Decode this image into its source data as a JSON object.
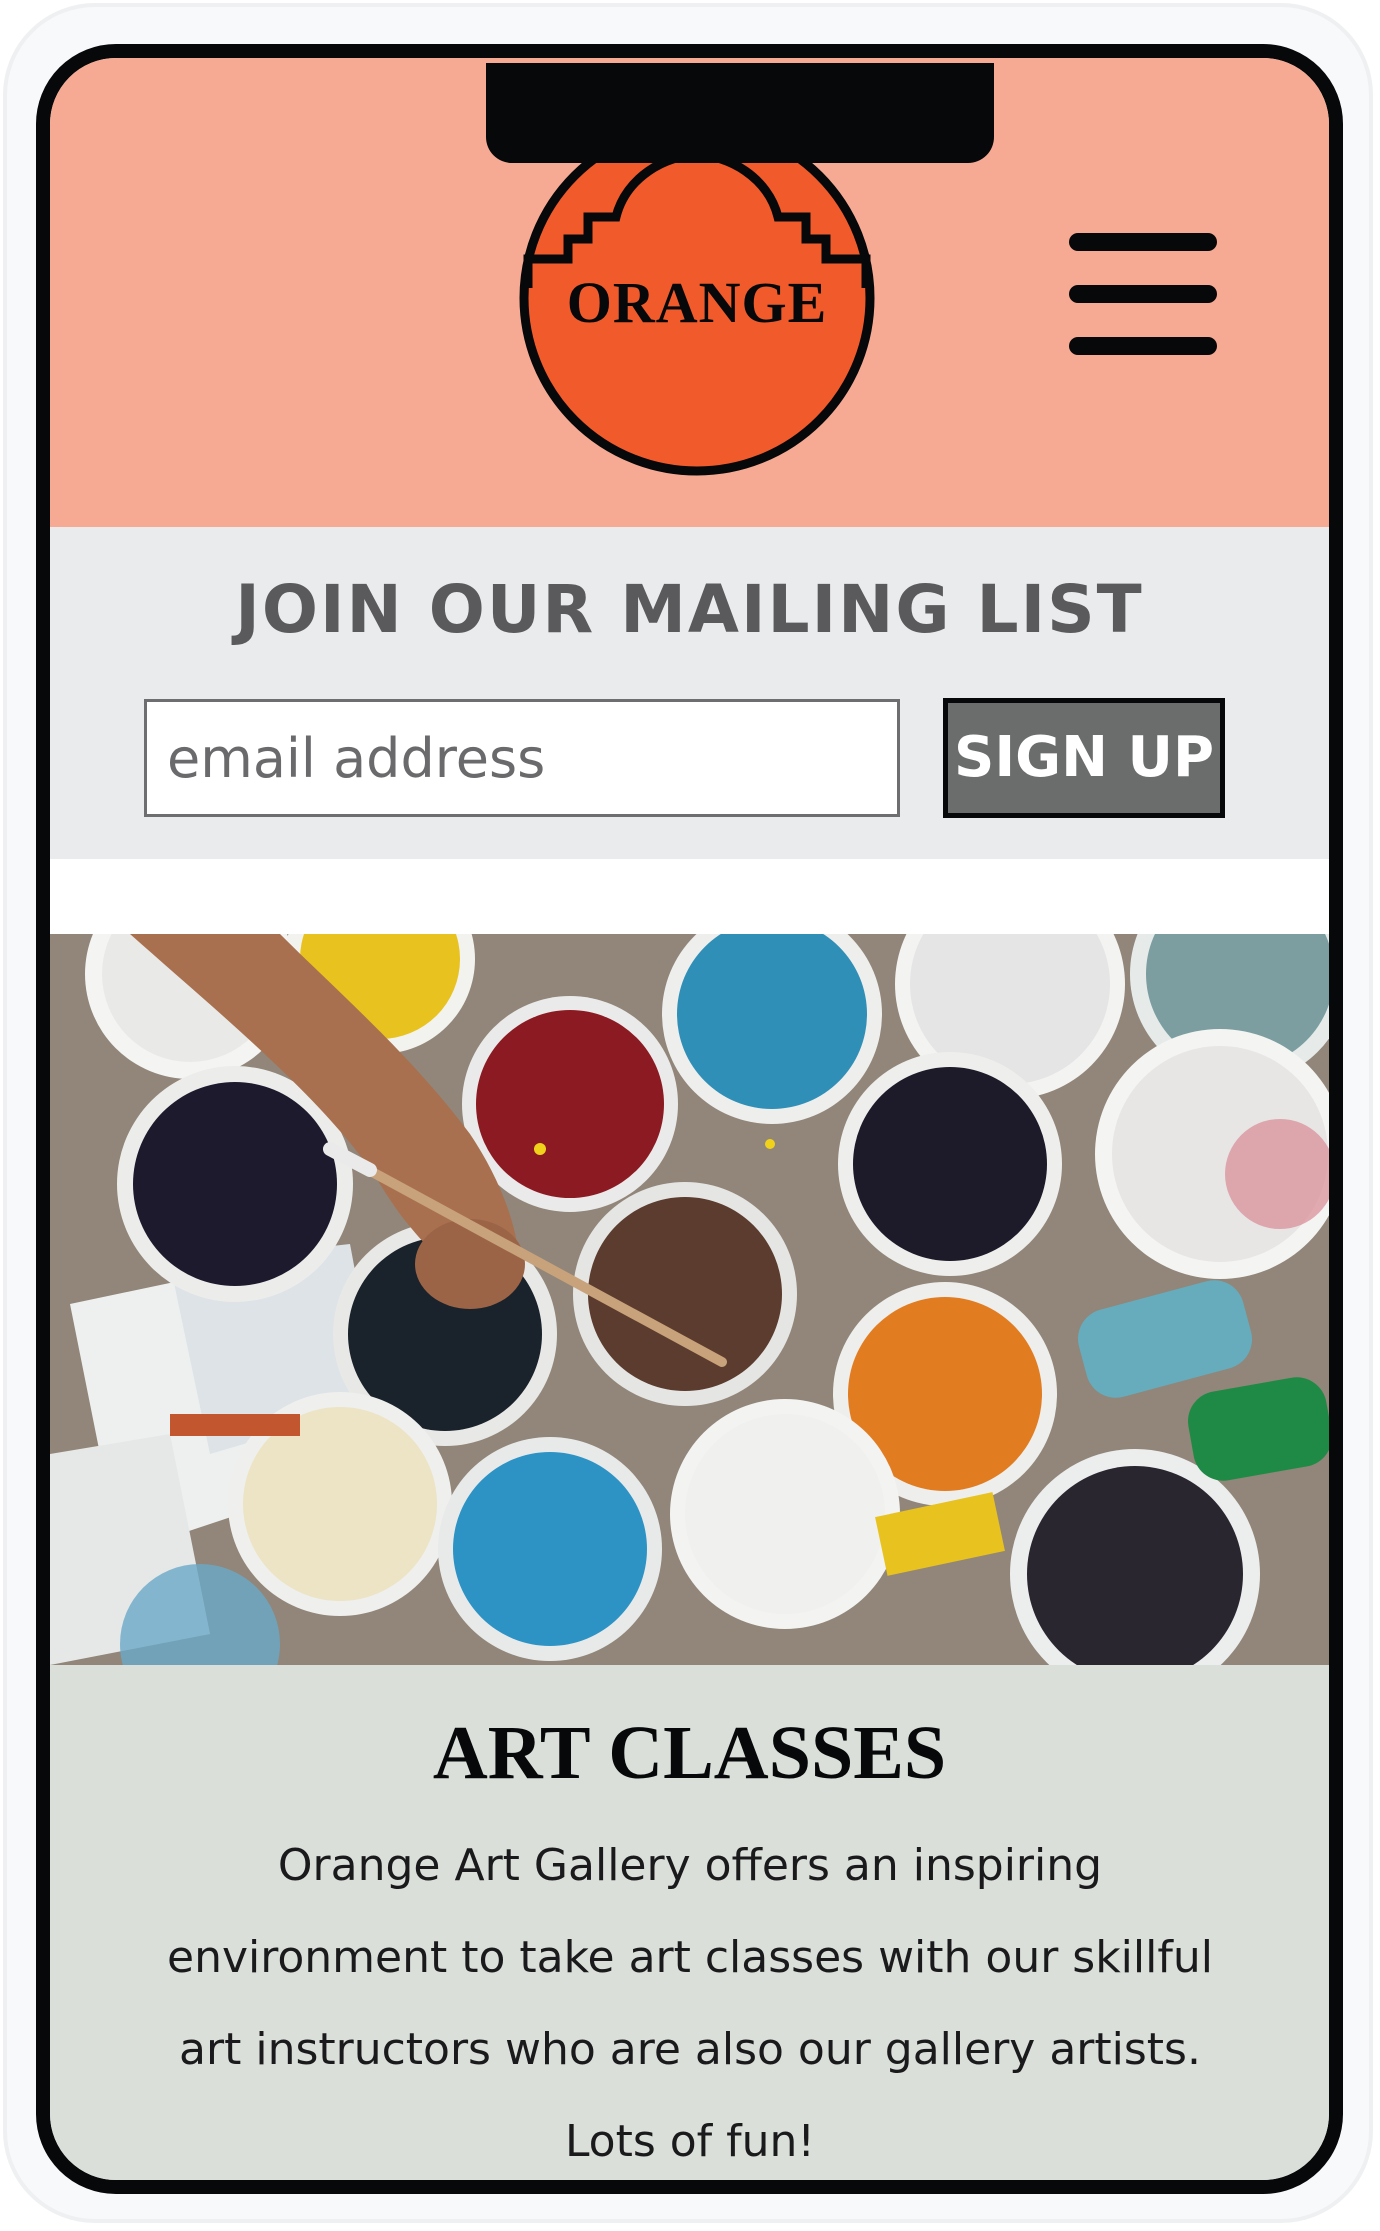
{
  "brand": {
    "logo_text": "ORANGE",
    "logo_color": "#f15a2b",
    "header_color": "#f7aa93"
  },
  "header": {
    "menu_icon": "hamburger-menu-icon"
  },
  "mailing_list": {
    "title": "JOIN OUR MAILING LIST",
    "email_placeholder": "email address",
    "signup_label": "SIGN UP"
  },
  "hero_image": {
    "alt": "paint buckets"
  },
  "art_classes": {
    "title": "ART CLASSES",
    "description": "Orange Art Gallery offers an inspiring environment to take art classes with our skillful art instructors who are also our gallery artists. Lots of fun!"
  }
}
